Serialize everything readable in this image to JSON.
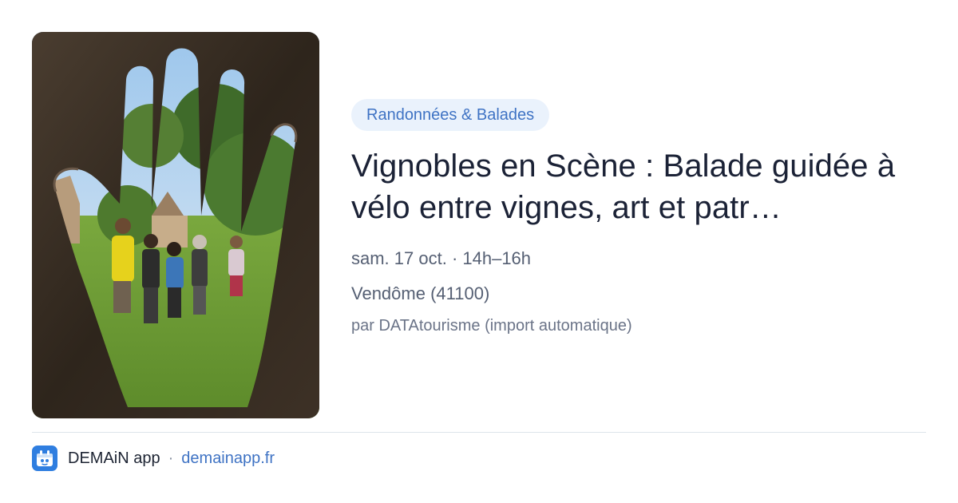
{
  "event": {
    "category": "Randonnées & Balades",
    "title": "Vignobles en Scène : Balade guidée à vélo entre vignes, art et patr…",
    "when": "sam. 17 oct. · 14h–16h",
    "where": "Vendôme (41100)",
    "source": "par DATAtourisme (import automatique)"
  },
  "footer": {
    "app_name": "DEMAiN app",
    "separator": "·",
    "domain": "demainapp.fr"
  },
  "colors": {
    "category_bg": "#eaf2fc",
    "category_text": "#3f73c4",
    "link": "#3f73c4",
    "app_icon_bg": "#2f7ee0"
  }
}
